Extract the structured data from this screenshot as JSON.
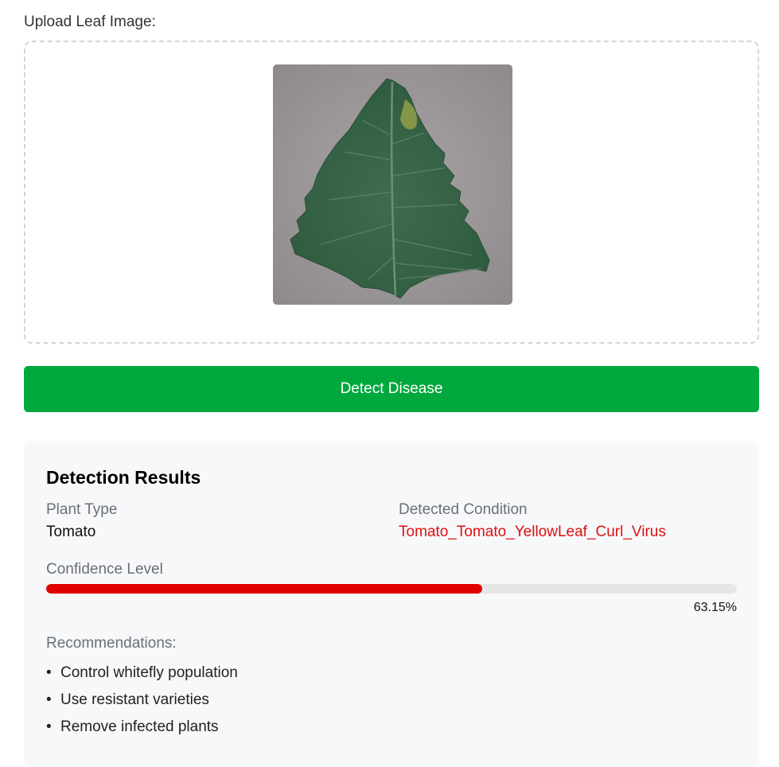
{
  "upload": {
    "label": "Upload Leaf Image:"
  },
  "detect_button": {
    "label": "Detect Disease",
    "color": "#00a83e"
  },
  "results": {
    "title": "Detection Results",
    "plant_type_label": "Plant Type",
    "plant_type_value": "Tomato",
    "condition_label": "Detected Condition",
    "condition_value": "Tomato_Tomato_YellowLeaf_Curl_Virus",
    "condition_color": "#dd1111",
    "confidence_label": "Confidence Level",
    "confidence_value": 63.15,
    "confidence_text": "63.15%",
    "confidence_color": "#e10000",
    "recommendations_label": "Recommendations:",
    "recommendations": [
      "Control whitefly population",
      "Use resistant varieties",
      "Remove infected plants"
    ]
  }
}
